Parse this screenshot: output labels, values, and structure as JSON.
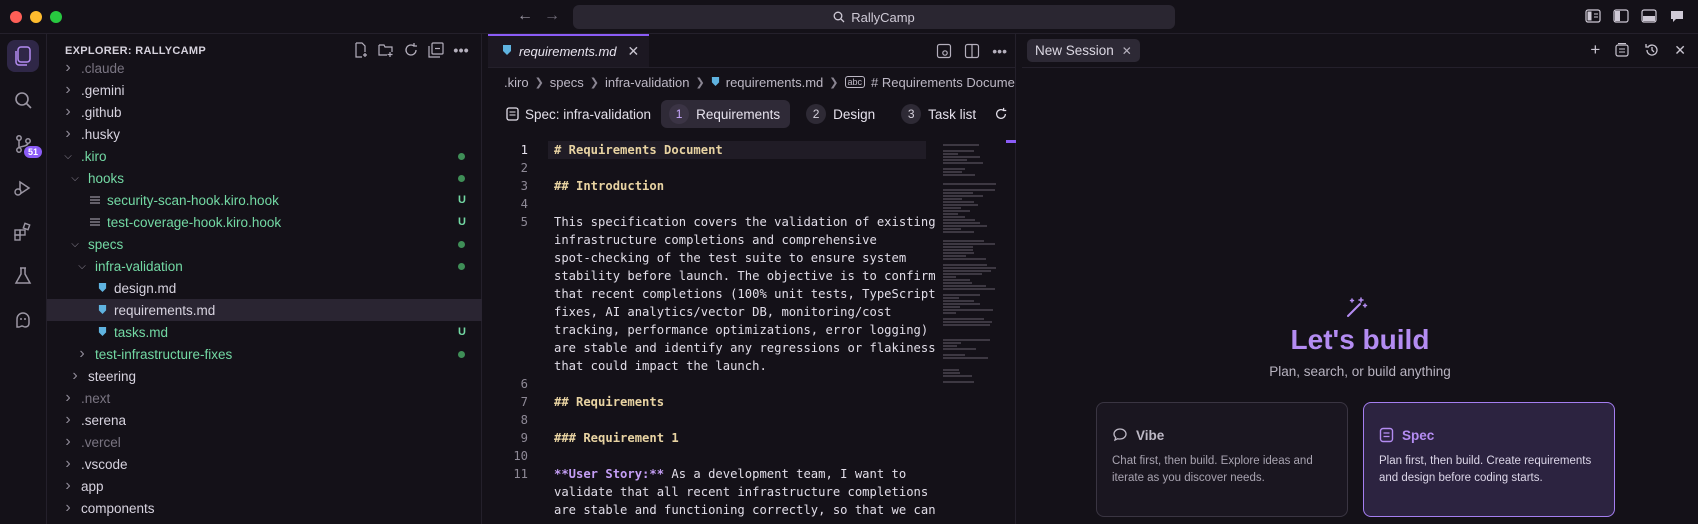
{
  "titlebar": {
    "search_label": "RallyCamp"
  },
  "activity": {
    "source_control_badge": "51"
  },
  "explorer": {
    "title": "EXPLORER: RALLYCAMP",
    "items": [
      {
        "label": ".claude",
        "indent": 0,
        "type": "folder",
        "open": false,
        "style": "dim",
        "status": ""
      },
      {
        "label": ".gemini",
        "indent": 0,
        "type": "folder",
        "open": false,
        "style": "norm",
        "status": ""
      },
      {
        "label": ".github",
        "indent": 0,
        "type": "folder",
        "open": false,
        "style": "norm",
        "status": ""
      },
      {
        "label": ".husky",
        "indent": 0,
        "type": "folder",
        "open": false,
        "style": "norm",
        "status": ""
      },
      {
        "label": ".kiro",
        "indent": 0,
        "type": "folder",
        "open": true,
        "style": "green",
        "status": "dot"
      },
      {
        "label": "hooks",
        "indent": 1,
        "type": "folder",
        "open": true,
        "style": "green",
        "status": "dot"
      },
      {
        "label": "security-scan-hook.kiro.hook",
        "indent": 2,
        "type": "hookfile",
        "open": false,
        "style": "green",
        "status": "U"
      },
      {
        "label": "test-coverage-hook.kiro.hook",
        "indent": 2,
        "type": "hookfile",
        "open": false,
        "style": "green",
        "status": "U"
      },
      {
        "label": "specs",
        "indent": 1,
        "type": "folder",
        "open": true,
        "style": "green",
        "status": "dot"
      },
      {
        "label": "infra-validation",
        "indent": 2,
        "type": "folder",
        "open": true,
        "style": "green",
        "status": "dot"
      },
      {
        "label": "design.md",
        "indent": 3,
        "type": "mdfile",
        "open": false,
        "style": "norm",
        "status": ""
      },
      {
        "label": "requirements.md",
        "indent": 3,
        "type": "mdfile",
        "open": false,
        "style": "norm",
        "status": "",
        "selected": true
      },
      {
        "label": "tasks.md",
        "indent": 3,
        "type": "mdfile",
        "open": false,
        "style": "green",
        "status": "U"
      },
      {
        "label": "test-infrastructure-fixes",
        "indent": 2,
        "type": "folder",
        "open": false,
        "style": "green",
        "status": "dot"
      },
      {
        "label": "steering",
        "indent": 1,
        "type": "folder",
        "open": false,
        "style": "norm",
        "status": ""
      },
      {
        "label": ".next",
        "indent": 0,
        "type": "folder",
        "open": false,
        "style": "dim",
        "status": ""
      },
      {
        "label": ".serena",
        "indent": 0,
        "type": "folder",
        "open": false,
        "style": "norm",
        "status": ""
      },
      {
        "label": ".vercel",
        "indent": 0,
        "type": "folder",
        "open": false,
        "style": "dim",
        "status": ""
      },
      {
        "label": ".vscode",
        "indent": 0,
        "type": "folder",
        "open": false,
        "style": "norm",
        "status": ""
      },
      {
        "label": "app",
        "indent": 0,
        "type": "folder",
        "open": false,
        "style": "norm",
        "status": ""
      },
      {
        "label": "components",
        "indent": 0,
        "type": "folder",
        "open": false,
        "style": "norm",
        "status": ""
      }
    ]
  },
  "editor": {
    "tab_label": "requirements.md",
    "breadcrumb": [
      ".kiro",
      "specs",
      "infra-validation",
      "requirements.md",
      "# Requirements Document"
    ],
    "spec_title": "Spec: infra-validation",
    "steps": [
      {
        "num": "1",
        "label": "Requirements",
        "active": true
      },
      {
        "num": "2",
        "label": "Design",
        "active": false
      },
      {
        "num": "3",
        "label": "Task list",
        "active": false
      }
    ],
    "refresh_label": "Re",
    "lines": [
      {
        "num": "1",
        "kind": "h",
        "text": "# Requirements Document",
        "current": true
      },
      {
        "num": "2",
        "kind": "blank",
        "text": ""
      },
      {
        "num": "3",
        "kind": "h",
        "text": "## Introduction"
      },
      {
        "num": "4",
        "kind": "blank",
        "text": ""
      },
      {
        "num": "5",
        "kind": "p",
        "text": "This specification covers the validation of existing"
      },
      {
        "num": "",
        "kind": "p",
        "text": "infrastructure completions and comprehensive"
      },
      {
        "num": "",
        "kind": "p",
        "text": "spot-checking of the test suite to ensure system"
      },
      {
        "num": "",
        "kind": "p",
        "text": "stability before launch. The objective is to confirm"
      },
      {
        "num": "",
        "kind": "p",
        "text": "that recent completions (100% unit tests, TypeScript"
      },
      {
        "num": "",
        "kind": "p",
        "text": "fixes, AI analytics/vector DB, monitoring/cost"
      },
      {
        "num": "",
        "kind": "p",
        "text": "tracking, performance optimizations, error logging)"
      },
      {
        "num": "",
        "kind": "p",
        "text": "are stable and identify any regressions or flakiness"
      },
      {
        "num": "",
        "kind": "p",
        "text": "that could impact the launch."
      },
      {
        "num": "6",
        "kind": "blank",
        "text": ""
      },
      {
        "num": "7",
        "kind": "h",
        "text": "## Requirements"
      },
      {
        "num": "8",
        "kind": "blank",
        "text": ""
      },
      {
        "num": "9",
        "kind": "h",
        "text": "### Requirement 1"
      },
      {
        "num": "10",
        "kind": "blank",
        "text": ""
      },
      {
        "num": "11",
        "kind": "story",
        "bold": "**User Story:**",
        "text": " As a development team, I want to"
      },
      {
        "num": "",
        "kind": "p",
        "text": "validate that all recent infrastructure completions"
      },
      {
        "num": "",
        "kind": "p",
        "text": "are stable and functioning correctly, so that we can"
      }
    ]
  },
  "panel": {
    "tab_label": "New Session",
    "hero_title": "Let's build",
    "hero_subtitle": "Plan, search, or build anything",
    "cards": {
      "vibe": {
        "title": "Vibe",
        "desc": "Chat first, then build. Explore ideas and iterate as you discover needs."
      },
      "spec": {
        "title": "Spec",
        "desc": "Plan first, then build. Create requirements and design before coding starts."
      }
    }
  },
  "colors": {
    "accent": "#8b5cf6",
    "hero": "#b48cf2",
    "git_added": "#73d9a4"
  }
}
